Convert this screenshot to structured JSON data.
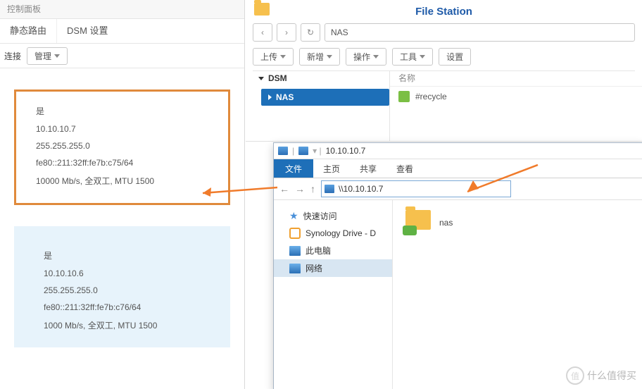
{
  "control_panel": {
    "title": "控制面板",
    "tabs": [
      "静态路由",
      "DSM 设置"
    ],
    "tool_connect": "连接",
    "tool_manage": "管理",
    "iface1": {
      "status": "是",
      "ip": "10.10.10.7",
      "mask": "255.255.255.0",
      "ipv6": "fe80::211:32ff:fe7b:c75/64",
      "link": "10000 Mb/s, 全双工, MTU 1500"
    },
    "iface2": {
      "status": "是",
      "ip": "10.10.10.6",
      "mask": "255.255.255.0",
      "ipv6": "fe80::211:32ff:fe7b:c76/64",
      "link": "1000 Mb/s, 全双工, MTU 1500"
    }
  },
  "file_station": {
    "title": "File Station",
    "path": "NAS",
    "nav": {
      "back": "‹",
      "fwd": "›",
      "reload": "↻"
    },
    "tools": {
      "upload": "上传",
      "create": "新增",
      "action": "操作",
      "tool": "工具",
      "setting": "设置"
    },
    "tree_root": "DSM",
    "tree_node": "NAS",
    "col_name": "名称",
    "item_recycle": "#recycle"
  },
  "explorer": {
    "title_ip": "10.10.10.7",
    "ribbon": {
      "file": "文件",
      "home": "主页",
      "share": "共享",
      "view": "查看"
    },
    "address": "\\\\10.10.10.7",
    "nav": {
      "quick": "快速访问",
      "sdrive": "Synology Drive - D",
      "pc": "此电脑",
      "network": "网络"
    },
    "item_nas": "nas"
  },
  "watermark": "什么值得买"
}
